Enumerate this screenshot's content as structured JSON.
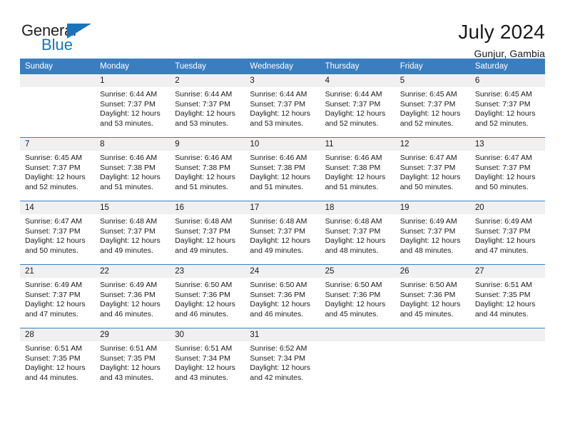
{
  "brand": {
    "name_top": "General",
    "name_bottom": "Blue",
    "triangle_color": "#1a74bb",
    "blue_text_color": "#1a74bb",
    "dark_text_color": "#231f20"
  },
  "header": {
    "title": "July 2024",
    "subtitle": "Gunjur, Gambia"
  },
  "theme": {
    "header_row_bg": "#3a7ec0",
    "header_row_text": "#ffffff",
    "daynum_bg": "#f0f0f0",
    "row_separator": "#3a7ec0",
    "body_text": "#1a1a1a"
  },
  "weekdays": [
    "Sunday",
    "Monday",
    "Tuesday",
    "Wednesday",
    "Thursday",
    "Friday",
    "Saturday"
  ],
  "labels": {
    "sunrise_prefix": "Sunrise:",
    "sunset_prefix": "Sunset:",
    "daylight_prefix": "Daylight:"
  },
  "weeks": [
    [
      {
        "empty": true
      },
      {
        "day": "1",
        "sunrise": "Sunrise: 6:44 AM",
        "sunset": "Sunset: 7:37 PM",
        "daylight1": "Daylight: 12 hours",
        "daylight2": "and 53 minutes."
      },
      {
        "day": "2",
        "sunrise": "Sunrise: 6:44 AM",
        "sunset": "Sunset: 7:37 PM",
        "daylight1": "Daylight: 12 hours",
        "daylight2": "and 53 minutes."
      },
      {
        "day": "3",
        "sunrise": "Sunrise: 6:44 AM",
        "sunset": "Sunset: 7:37 PM",
        "daylight1": "Daylight: 12 hours",
        "daylight2": "and 53 minutes."
      },
      {
        "day": "4",
        "sunrise": "Sunrise: 6:44 AM",
        "sunset": "Sunset: 7:37 PM",
        "daylight1": "Daylight: 12 hours",
        "daylight2": "and 52 minutes."
      },
      {
        "day": "5",
        "sunrise": "Sunrise: 6:45 AM",
        "sunset": "Sunset: 7:37 PM",
        "daylight1": "Daylight: 12 hours",
        "daylight2": "and 52 minutes."
      },
      {
        "day": "6",
        "sunrise": "Sunrise: 6:45 AM",
        "sunset": "Sunset: 7:37 PM",
        "daylight1": "Daylight: 12 hours",
        "daylight2": "and 52 minutes."
      }
    ],
    [
      {
        "day": "7",
        "sunrise": "Sunrise: 6:45 AM",
        "sunset": "Sunset: 7:37 PM",
        "daylight1": "Daylight: 12 hours",
        "daylight2": "and 52 minutes."
      },
      {
        "day": "8",
        "sunrise": "Sunrise: 6:46 AM",
        "sunset": "Sunset: 7:38 PM",
        "daylight1": "Daylight: 12 hours",
        "daylight2": "and 51 minutes."
      },
      {
        "day": "9",
        "sunrise": "Sunrise: 6:46 AM",
        "sunset": "Sunset: 7:38 PM",
        "daylight1": "Daylight: 12 hours",
        "daylight2": "and 51 minutes."
      },
      {
        "day": "10",
        "sunrise": "Sunrise: 6:46 AM",
        "sunset": "Sunset: 7:38 PM",
        "daylight1": "Daylight: 12 hours",
        "daylight2": "and 51 minutes."
      },
      {
        "day": "11",
        "sunrise": "Sunrise: 6:46 AM",
        "sunset": "Sunset: 7:38 PM",
        "daylight1": "Daylight: 12 hours",
        "daylight2": "and 51 minutes."
      },
      {
        "day": "12",
        "sunrise": "Sunrise: 6:47 AM",
        "sunset": "Sunset: 7:37 PM",
        "daylight1": "Daylight: 12 hours",
        "daylight2": "and 50 minutes."
      },
      {
        "day": "13",
        "sunrise": "Sunrise: 6:47 AM",
        "sunset": "Sunset: 7:37 PM",
        "daylight1": "Daylight: 12 hours",
        "daylight2": "and 50 minutes."
      }
    ],
    [
      {
        "day": "14",
        "sunrise": "Sunrise: 6:47 AM",
        "sunset": "Sunset: 7:37 PM",
        "daylight1": "Daylight: 12 hours",
        "daylight2": "and 50 minutes."
      },
      {
        "day": "15",
        "sunrise": "Sunrise: 6:48 AM",
        "sunset": "Sunset: 7:37 PM",
        "daylight1": "Daylight: 12 hours",
        "daylight2": "and 49 minutes."
      },
      {
        "day": "16",
        "sunrise": "Sunrise: 6:48 AM",
        "sunset": "Sunset: 7:37 PM",
        "daylight1": "Daylight: 12 hours",
        "daylight2": "and 49 minutes."
      },
      {
        "day": "17",
        "sunrise": "Sunrise: 6:48 AM",
        "sunset": "Sunset: 7:37 PM",
        "daylight1": "Daylight: 12 hours",
        "daylight2": "and 49 minutes."
      },
      {
        "day": "18",
        "sunrise": "Sunrise: 6:48 AM",
        "sunset": "Sunset: 7:37 PM",
        "daylight1": "Daylight: 12 hours",
        "daylight2": "and 48 minutes."
      },
      {
        "day": "19",
        "sunrise": "Sunrise: 6:49 AM",
        "sunset": "Sunset: 7:37 PM",
        "daylight1": "Daylight: 12 hours",
        "daylight2": "and 48 minutes."
      },
      {
        "day": "20",
        "sunrise": "Sunrise: 6:49 AM",
        "sunset": "Sunset: 7:37 PM",
        "daylight1": "Daylight: 12 hours",
        "daylight2": "and 47 minutes."
      }
    ],
    [
      {
        "day": "21",
        "sunrise": "Sunrise: 6:49 AM",
        "sunset": "Sunset: 7:37 PM",
        "daylight1": "Daylight: 12 hours",
        "daylight2": "and 47 minutes."
      },
      {
        "day": "22",
        "sunrise": "Sunrise: 6:49 AM",
        "sunset": "Sunset: 7:36 PM",
        "daylight1": "Daylight: 12 hours",
        "daylight2": "and 46 minutes."
      },
      {
        "day": "23",
        "sunrise": "Sunrise: 6:50 AM",
        "sunset": "Sunset: 7:36 PM",
        "daylight1": "Daylight: 12 hours",
        "daylight2": "and 46 minutes."
      },
      {
        "day": "24",
        "sunrise": "Sunrise: 6:50 AM",
        "sunset": "Sunset: 7:36 PM",
        "daylight1": "Daylight: 12 hours",
        "daylight2": "and 46 minutes."
      },
      {
        "day": "25",
        "sunrise": "Sunrise: 6:50 AM",
        "sunset": "Sunset: 7:36 PM",
        "daylight1": "Daylight: 12 hours",
        "daylight2": "and 45 minutes."
      },
      {
        "day": "26",
        "sunrise": "Sunrise: 6:50 AM",
        "sunset": "Sunset: 7:36 PM",
        "daylight1": "Daylight: 12 hours",
        "daylight2": "and 45 minutes."
      },
      {
        "day": "27",
        "sunrise": "Sunrise: 6:51 AM",
        "sunset": "Sunset: 7:35 PM",
        "daylight1": "Daylight: 12 hours",
        "daylight2": "and 44 minutes."
      }
    ],
    [
      {
        "day": "28",
        "sunrise": "Sunrise: 6:51 AM",
        "sunset": "Sunset: 7:35 PM",
        "daylight1": "Daylight: 12 hours",
        "daylight2": "and 44 minutes."
      },
      {
        "day": "29",
        "sunrise": "Sunrise: 6:51 AM",
        "sunset": "Sunset: 7:35 PM",
        "daylight1": "Daylight: 12 hours",
        "daylight2": "and 43 minutes."
      },
      {
        "day": "30",
        "sunrise": "Sunrise: 6:51 AM",
        "sunset": "Sunset: 7:34 PM",
        "daylight1": "Daylight: 12 hours",
        "daylight2": "and 43 minutes."
      },
      {
        "day": "31",
        "sunrise": "Sunrise: 6:52 AM",
        "sunset": "Sunset: 7:34 PM",
        "daylight1": "Daylight: 12 hours",
        "daylight2": "and 42 minutes."
      },
      {
        "empty": true
      },
      {
        "empty": true
      },
      {
        "empty": true
      }
    ]
  ]
}
